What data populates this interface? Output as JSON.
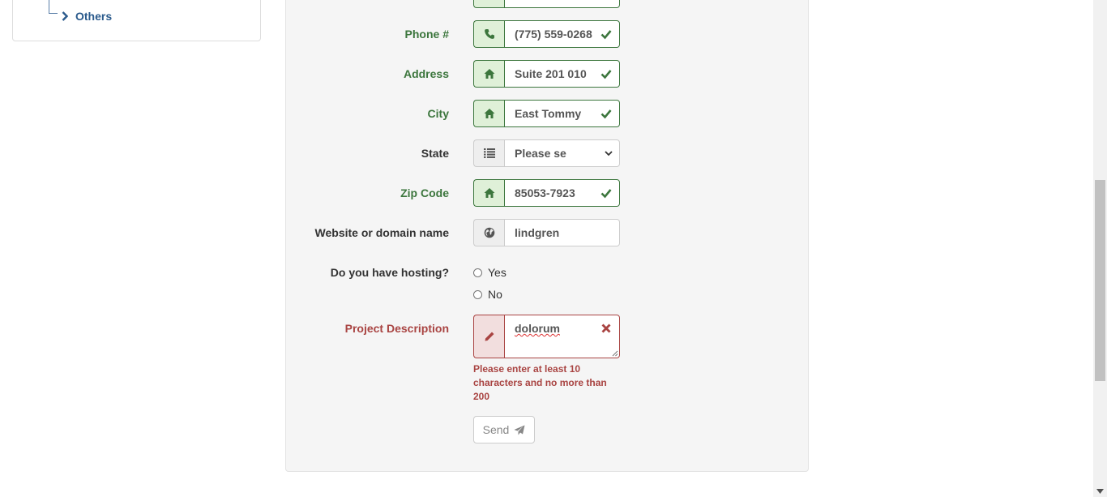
{
  "sidebar": {
    "items": [
      {
        "label": "Others"
      }
    ]
  },
  "form": {
    "phone": {
      "label": "Phone #",
      "value": "(775) 559-0268",
      "icon": "phone-icon"
    },
    "address": {
      "label": "Address",
      "value": "Suite 201 010",
      "icon": "home-icon"
    },
    "city": {
      "label": "City",
      "value": "East Tommy",
      "icon": "home-icon"
    },
    "state": {
      "label": "State",
      "selected": "Please se",
      "icon": "list-icon"
    },
    "zip": {
      "label": "Zip Code",
      "value": "85053-7923",
      "icon": "home-icon"
    },
    "website": {
      "label": "Website or domain name",
      "value": "lindgren",
      "icon": "globe-icon"
    },
    "hosting": {
      "label": "Do you have hosting?",
      "options": [
        {
          "label": "Yes"
        },
        {
          "label": "No"
        }
      ]
    },
    "description": {
      "label": "Project Description",
      "value": "dolorum",
      "error": "Please enter at least 10 characters and no more than 200",
      "icon": "pencil-icon"
    },
    "send_label": "Send"
  },
  "colors": {
    "success": "#3c763d",
    "success_bg": "#dff0d8",
    "error": "#a94442",
    "error_bg": "#f2dede",
    "link": "#2a5a8c"
  }
}
